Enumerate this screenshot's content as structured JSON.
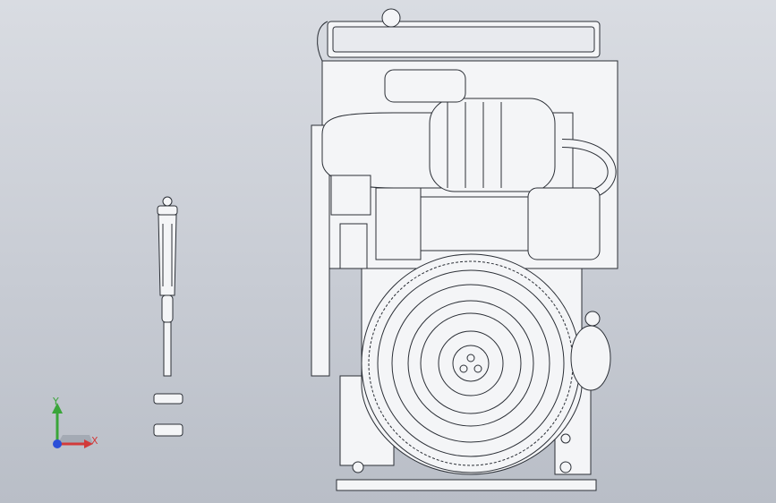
{
  "view": {
    "background_top": "#d9dce2",
    "background_bottom": "#b9bec7",
    "model_fill": "#f4f5f7",
    "model_edge": "#2b2f36",
    "model_shadow": "#c3c8d0"
  },
  "triad": {
    "x_label": "X",
    "y_label": "Y",
    "x_color": "#d23a3a",
    "y_color": "#3aa53a",
    "z_color": "#2b4fd8"
  },
  "icons": {
    "triad": "coordinate-triad-icon"
  }
}
